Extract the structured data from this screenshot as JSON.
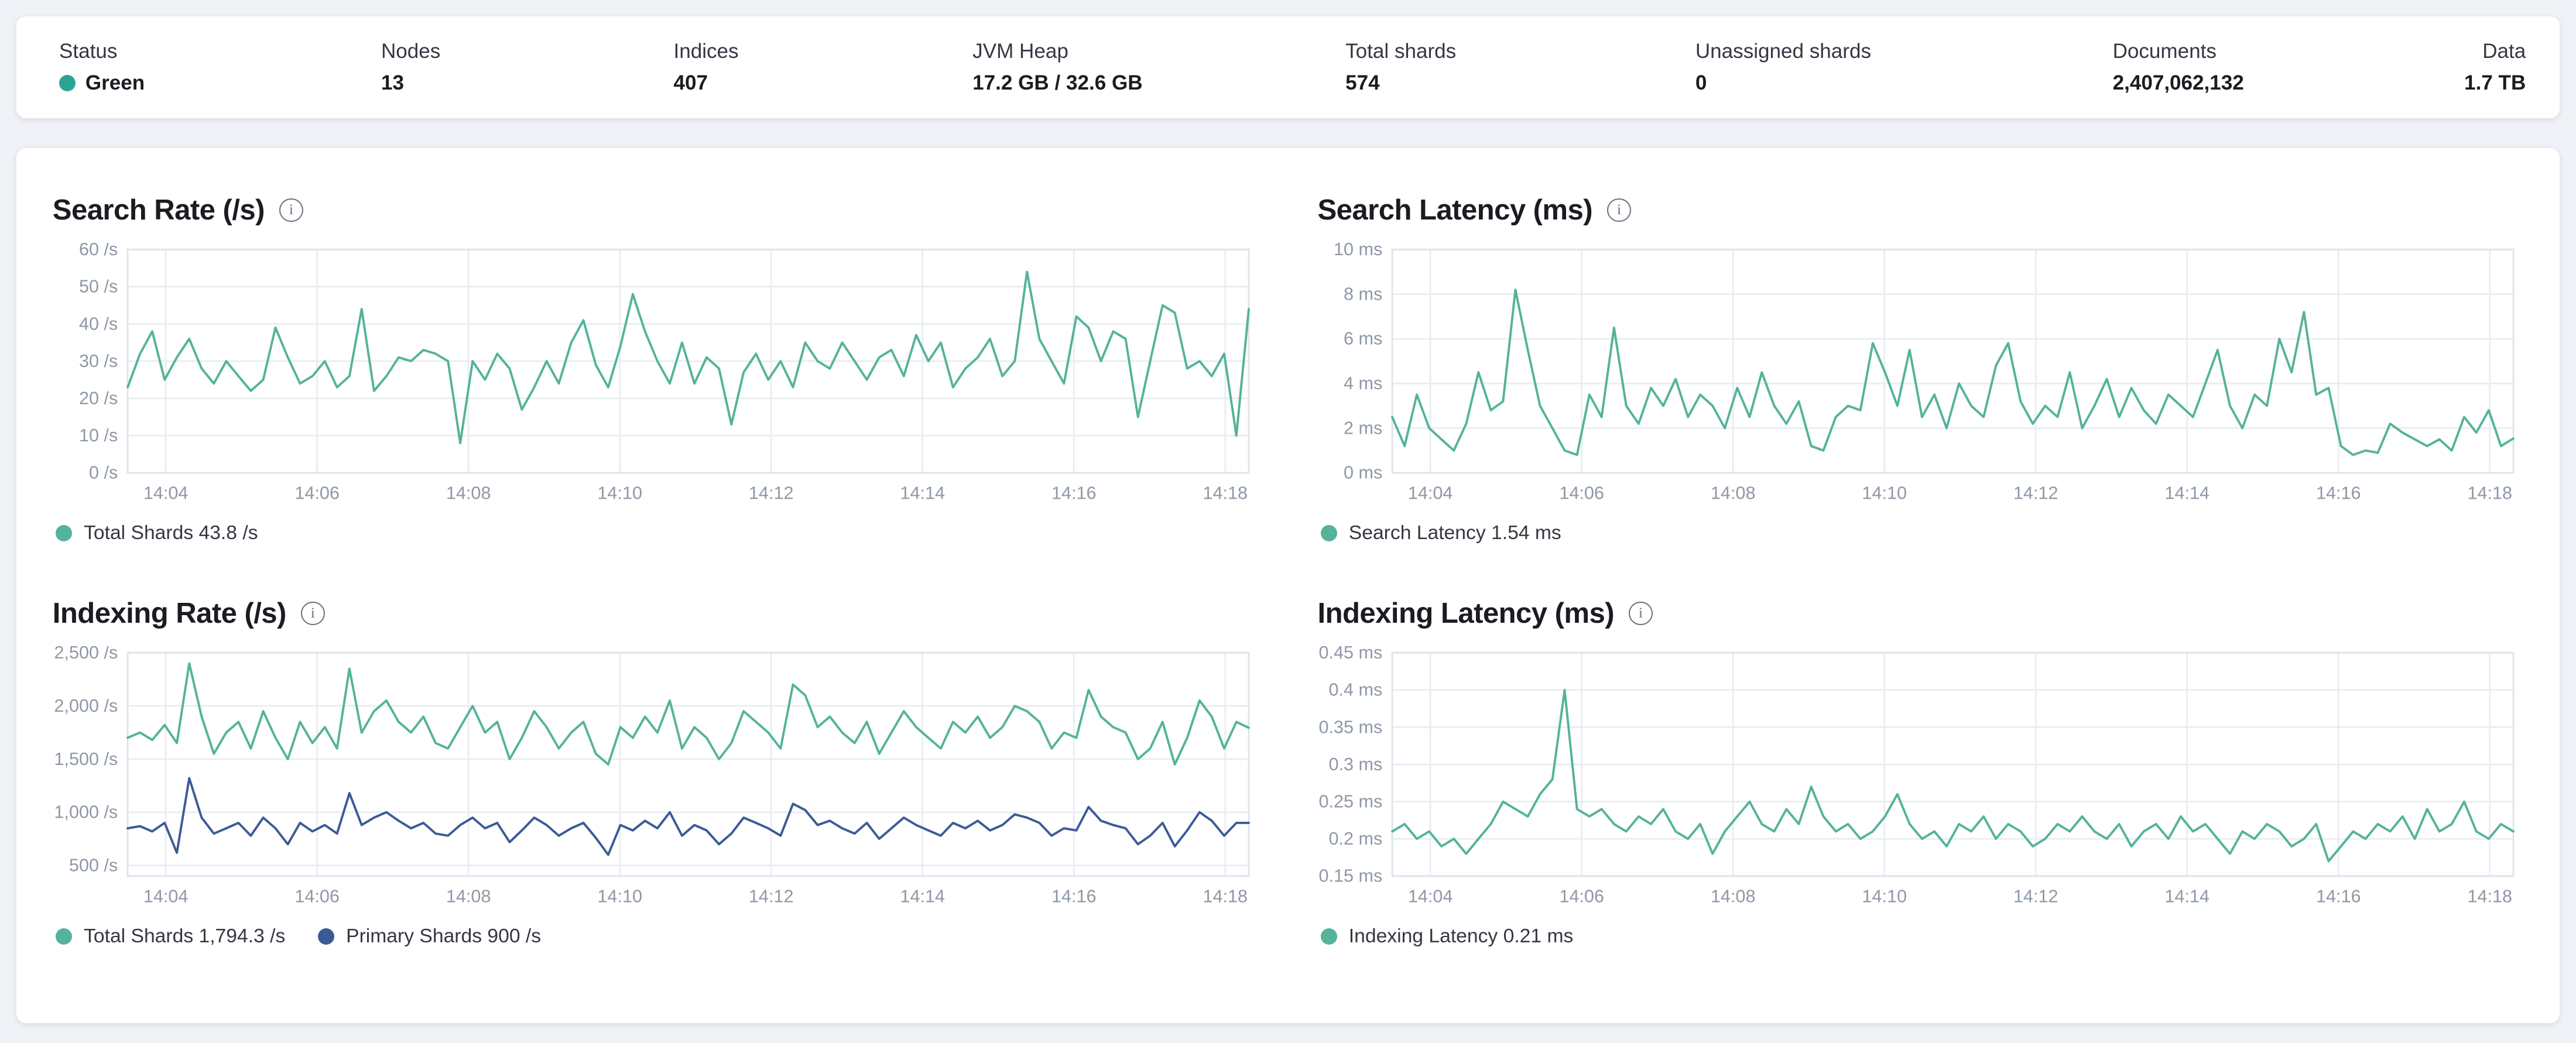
{
  "status_bar": {
    "items": [
      {
        "label": "Status",
        "value": "Green",
        "dot_color": "#2ba593"
      },
      {
        "label": "Nodes",
        "value": "13"
      },
      {
        "label": "Indices",
        "value": "407"
      },
      {
        "label": "JVM Heap",
        "value": "17.2 GB / 32.6 GB"
      },
      {
        "label": "Total shards",
        "value": "574"
      },
      {
        "label": "Unassigned shards",
        "value": "0"
      },
      {
        "label": "Documents",
        "value": "2,407,062,132"
      },
      {
        "label": "Data",
        "value": "1.7 TB"
      }
    ]
  },
  "colors": {
    "teal": "#54b399",
    "navy": "#3c5a96",
    "grid": "#e9edf3",
    "axis_text": "#8e98a6"
  },
  "chart_data": [
    {
      "type": "line",
      "title": "Search Rate (/s)",
      "ylabel": "/s",
      "ylim": [
        0,
        60
      ],
      "y_ticks": [
        {
          "value": 0,
          "label": "0 /s"
        },
        {
          "value": 10,
          "label": "10 /s"
        },
        {
          "value": 20,
          "label": "20 /s"
        },
        {
          "value": 30,
          "label": "30 /s"
        },
        {
          "value": 40,
          "label": "40 /s"
        },
        {
          "value": 50,
          "label": "50 /s"
        },
        {
          "value": 60,
          "label": "60 /s"
        }
      ],
      "x_ticks": [
        "14:04",
        "14:06",
        "14:08",
        "14:10",
        "14:12",
        "14:14",
        "14:16",
        "14:18"
      ],
      "x_tick_fracs": [
        0.034,
        0.169,
        0.304,
        0.439,
        0.574,
        0.709,
        0.844,
        0.979
      ],
      "series": [
        {
          "name": "Total Shards",
          "color": "#54b399",
          "values": [
            23,
            32,
            38,
            25,
            31,
            36,
            28,
            24,
            30,
            26,
            22,
            25,
            39,
            31,
            24,
            26,
            30,
            23,
            26,
            44,
            22,
            26,
            31,
            30,
            33,
            32,
            30,
            8,
            30,
            25,
            32,
            28,
            17,
            23,
            30,
            24,
            35,
            41,
            29,
            23,
            34,
            48,
            38,
            30,
            24,
            35,
            24,
            31,
            28,
            13,
            27,
            32,
            25,
            30,
            23,
            35,
            30,
            28,
            35,
            30,
            25,
            31,
            33,
            26,
            37,
            30,
            35,
            23,
            28,
            31,
            36,
            26,
            30,
            54,
            36,
            30,
            24,
            42,
            39,
            30,
            38,
            36,
            15,
            30,
            45,
            43,
            28,
            30,
            26,
            32,
            10,
            44
          ]
        }
      ],
      "legend": [
        {
          "label": "Total Shards 43.8 /s",
          "color": "#54b399"
        }
      ]
    },
    {
      "type": "line",
      "title": "Search Latency (ms)",
      "ylabel": "ms",
      "ylim": [
        0,
        10
      ],
      "y_ticks": [
        {
          "value": 0,
          "label": "0 ms"
        },
        {
          "value": 2,
          "label": "2 ms"
        },
        {
          "value": 4,
          "label": "4 ms"
        },
        {
          "value": 6,
          "label": "6 ms"
        },
        {
          "value": 8,
          "label": "8 ms"
        },
        {
          "value": 10,
          "label": "10 ms"
        }
      ],
      "x_ticks": [
        "14:04",
        "14:06",
        "14:08",
        "14:10",
        "14:12",
        "14:14",
        "14:16",
        "14:18"
      ],
      "x_tick_fracs": [
        0.034,
        0.169,
        0.304,
        0.439,
        0.574,
        0.709,
        0.844,
        0.979
      ],
      "series": [
        {
          "name": "Search Latency",
          "color": "#54b399",
          "values": [
            2.5,
            1.2,
            3.5,
            2.0,
            1.5,
            1.0,
            2.2,
            4.5,
            2.8,
            3.2,
            8.2,
            5.5,
            3.0,
            2.0,
            1.0,
            0.8,
            3.5,
            2.5,
            6.5,
            3.0,
            2.2,
            3.8,
            3.0,
            4.2,
            2.5,
            3.5,
            3.0,
            2.0,
            3.8,
            2.5,
            4.5,
            3.0,
            2.2,
            3.2,
            1.2,
            1.0,
            2.5,
            3.0,
            2.8,
            5.8,
            4.5,
            3.0,
            5.5,
            2.5,
            3.5,
            2.0,
            4.0,
            3.0,
            2.5,
            4.8,
            5.8,
            3.2,
            2.2,
            3.0,
            2.5,
            4.5,
            2.0,
            3.0,
            4.2,
            2.5,
            3.8,
            2.8,
            2.2,
            3.5,
            3.0,
            2.5,
            4.0,
            5.5,
            3.0,
            2.0,
            3.5,
            3.0,
            6.0,
            4.5,
            7.2,
            3.5,
            3.8,
            1.2,
            0.8,
            1.0,
            0.9,
            2.2,
            1.8,
            1.5,
            1.2,
            1.5,
            1.0,
            2.5,
            1.8,
            2.8,
            1.2,
            1.54
          ]
        }
      ],
      "legend": [
        {
          "label": "Search Latency 1.54 ms",
          "color": "#54b399"
        }
      ]
    },
    {
      "type": "line",
      "title": "Indexing Rate (/s)",
      "ylabel": "/s",
      "ylim": [
        400,
        2500
      ],
      "y_ticks": [
        {
          "value": 500,
          "label": "500 /s"
        },
        {
          "value": 1000,
          "label": "1,000 /s"
        },
        {
          "value": 1500,
          "label": "1,500 /s"
        },
        {
          "value": 2000,
          "label": "2,000 /s"
        },
        {
          "value": 2500,
          "label": "2,500 /s"
        }
      ],
      "x_ticks": [
        "14:04",
        "14:06",
        "14:08",
        "14:10",
        "14:12",
        "14:14",
        "14:16",
        "14:18"
      ],
      "x_tick_fracs": [
        0.034,
        0.169,
        0.304,
        0.439,
        0.574,
        0.709,
        0.844,
        0.979
      ],
      "series": [
        {
          "name": "Total Shards",
          "color": "#54b399",
          "values": [
            1700,
            1750,
            1680,
            1820,
            1650,
            2400,
            1900,
            1550,
            1750,
            1850,
            1600,
            1950,
            1700,
            1500,
            1850,
            1650,
            1800,
            1600,
            2350,
            1750,
            1950,
            2050,
            1850,
            1750,
            1900,
            1650,
            1600,
            1800,
            2000,
            1750,
            1850,
            1500,
            1700,
            1950,
            1800,
            1600,
            1750,
            1850,
            1550,
            1450,
            1800,
            1700,
            1900,
            1750,
            2050,
            1600,
            1800,
            1700,
            1500,
            1650,
            1950,
            1850,
            1750,
            1600,
            2200,
            2100,
            1800,
            1900,
            1750,
            1650,
            1850,
            1550,
            1750,
            1950,
            1800,
            1700,
            1600,
            1850,
            1750,
            1900,
            1700,
            1800,
            2000,
            1950,
            1850,
            1600,
            1750,
            1700,
            2150,
            1900,
            1800,
            1750,
            1500,
            1600,
            1850,
            1450,
            1700,
            2050,
            1900,
            1600,
            1850,
            1794
          ]
        },
        {
          "name": "Primary Shards",
          "color": "#3c5a96",
          "values": [
            850,
            870,
            820,
            900,
            620,
            1320,
            950,
            800,
            850,
            900,
            780,
            950,
            850,
            700,
            900,
            820,
            880,
            800,
            1180,
            880,
            950,
            1000,
            920,
            850,
            900,
            800,
            780,
            880,
            950,
            850,
            900,
            720,
            830,
            950,
            880,
            780,
            850,
            900,
            760,
            600,
            880,
            830,
            920,
            850,
            1000,
            780,
            880,
            830,
            700,
            800,
            950,
            900,
            850,
            780,
            1080,
            1020,
            880,
            920,
            850,
            800,
            900,
            750,
            850,
            950,
            880,
            830,
            780,
            900,
            850,
            920,
            830,
            880,
            980,
            950,
            900,
            780,
            850,
            830,
            1050,
            920,
            880,
            850,
            700,
            780,
            900,
            680,
            830,
            1000,
            920,
            780,
            900,
            900
          ]
        }
      ],
      "legend": [
        {
          "label": "Total Shards 1,794.3 /s",
          "color": "#54b399"
        },
        {
          "label": "Primary Shards 900 /s",
          "color": "#3c5a96"
        }
      ]
    },
    {
      "type": "line",
      "title": "Indexing Latency (ms)",
      "ylabel": "ms",
      "ylim": [
        0.15,
        0.45
      ],
      "y_ticks": [
        {
          "value": 0.15,
          "label": "0.15 ms"
        },
        {
          "value": 0.2,
          "label": "0.2 ms"
        },
        {
          "value": 0.25,
          "label": "0.25 ms"
        },
        {
          "value": 0.3,
          "label": "0.3 ms"
        },
        {
          "value": 0.35,
          "label": "0.35 ms"
        },
        {
          "value": 0.4,
          "label": "0.4 ms"
        },
        {
          "value": 0.45,
          "label": "0.45 ms"
        }
      ],
      "x_ticks": [
        "14:04",
        "14:06",
        "14:08",
        "14:10",
        "14:12",
        "14:14",
        "14:16",
        "14:18"
      ],
      "x_tick_fracs": [
        0.034,
        0.169,
        0.304,
        0.439,
        0.574,
        0.709,
        0.844,
        0.979
      ],
      "series": [
        {
          "name": "Indexing Latency",
          "color": "#54b399",
          "values": [
            0.21,
            0.22,
            0.2,
            0.21,
            0.19,
            0.2,
            0.18,
            0.2,
            0.22,
            0.25,
            0.24,
            0.23,
            0.26,
            0.28,
            0.4,
            0.24,
            0.23,
            0.24,
            0.22,
            0.21,
            0.23,
            0.22,
            0.24,
            0.21,
            0.2,
            0.22,
            0.18,
            0.21,
            0.23,
            0.25,
            0.22,
            0.21,
            0.24,
            0.22,
            0.27,
            0.23,
            0.21,
            0.22,
            0.2,
            0.21,
            0.23,
            0.26,
            0.22,
            0.2,
            0.21,
            0.19,
            0.22,
            0.21,
            0.23,
            0.2,
            0.22,
            0.21,
            0.19,
            0.2,
            0.22,
            0.21,
            0.23,
            0.21,
            0.2,
            0.22,
            0.19,
            0.21,
            0.22,
            0.2,
            0.23,
            0.21,
            0.22,
            0.2,
            0.18,
            0.21,
            0.2,
            0.22,
            0.21,
            0.19,
            0.2,
            0.22,
            0.17,
            0.19,
            0.21,
            0.2,
            0.22,
            0.21,
            0.23,
            0.2,
            0.24,
            0.21,
            0.22,
            0.25,
            0.21,
            0.2,
            0.22,
            0.21
          ]
        }
      ],
      "legend": [
        {
          "label": "Indexing Latency 0.21 ms",
          "color": "#54b399"
        }
      ]
    }
  ]
}
